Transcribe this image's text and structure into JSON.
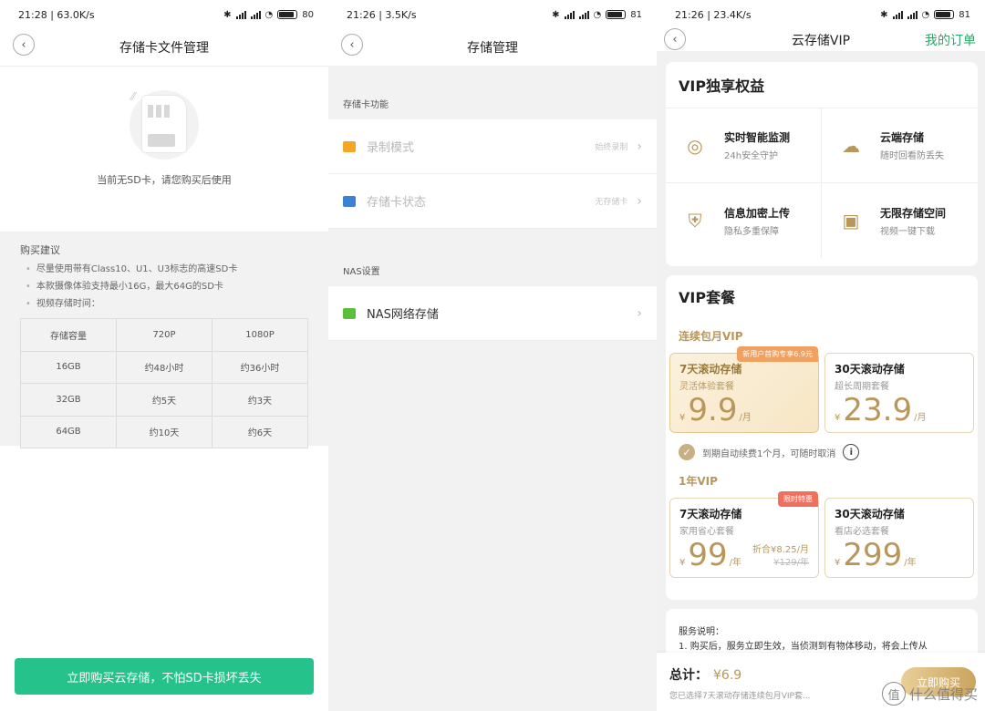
{
  "panel1": {
    "status": {
      "time": "21:28",
      "speed": "63.0K/s",
      "battery": "80"
    },
    "nav": {
      "title": "存储卡文件管理",
      "back_glyph": "‹"
    },
    "empty_msg": "当前无SD卡，请您购买后使用",
    "advice": {
      "heading": "购买建议",
      "items": [
        "尽量使用带有Class10、U1、U3标志的高速SD卡",
        "本款摄像体验支持最小16G，最大64G的SD卡",
        "视频存储时间："
      ]
    },
    "table": {
      "header": [
        "存储容量",
        "720P",
        "1080P"
      ],
      "rows": [
        [
          "16GB",
          "约48小时",
          "约36小时"
        ],
        [
          "32GB",
          "约5天",
          "约3天"
        ],
        [
          "64GB",
          "约10天",
          "约6天"
        ]
      ]
    },
    "buy_button": "立即购买云存储，不怕SD卡损坏丢失",
    "colors": {
      "accent": "#26c28b"
    }
  },
  "panel2": {
    "status": {
      "time": "21:26",
      "speed": "3.5K/s",
      "battery": "81"
    },
    "nav": {
      "title": "存储管理",
      "back_glyph": "‹"
    },
    "section1": "存储卡功能",
    "rows1": [
      {
        "label": "录制模式",
        "value": "始终录制",
        "icon": "video-record-icon",
        "color": "#f5a623"
      },
      {
        "label": "存储卡状态",
        "value": "无存储卡",
        "icon": "sd-card-icon",
        "color": "#3b82d6"
      }
    ],
    "section2": "NAS设置",
    "rows2": [
      {
        "label": "NAS网络存储",
        "icon": "nas-drive-icon",
        "color": "#5cbf3c"
      }
    ]
  },
  "panel3": {
    "status": {
      "time": "21:26",
      "speed": "23.4K/s",
      "battery": "81"
    },
    "nav": {
      "title": "云存储VIP",
      "back_glyph": "‹",
      "my_orders": "我的订单"
    },
    "benefits_title": "VIP独享权益",
    "benefits": [
      {
        "title": "实时智能监测",
        "sub": "24h安全守护",
        "icon": "smart-monitor-icon"
      },
      {
        "title": "云端存储",
        "sub": "随时回看防丢失",
        "icon": "cloud-upload-icon"
      },
      {
        "title": "信息加密上传",
        "sub": "隐私多重保障",
        "icon": "shield-encrypt-icon"
      },
      {
        "title": "无限存储空间",
        "sub": "视频一键下载",
        "icon": "save-disk-icon"
      }
    ],
    "packages_title": "VIP套餐",
    "monthly": {
      "heading": "连续包月VIP",
      "plans": [
        {
          "title": "7天滚动存储",
          "sub": "灵活体验套餐",
          "currency": "¥",
          "price": "9.9",
          "unit": "/月",
          "badge": "新用户首购专享6.9元"
        },
        {
          "title": "30天滚动存储",
          "sub": "超长周期套餐",
          "currency": "¥",
          "price": "23.9",
          "unit": "/月"
        }
      ]
    },
    "renew_text": "到期自动续费1个月，可随时取消",
    "yearly": {
      "heading": "1年VIP",
      "plans": [
        {
          "title": "7天滚动存储",
          "sub": "家用省心套餐",
          "currency": "¥",
          "price": "99",
          "unit": "/年",
          "badge": "限时特惠",
          "monthly_equiv": "折合¥8.25/月",
          "original": "¥129/年"
        },
        {
          "title": "30天滚动存储",
          "sub": "看店必选套餐",
          "currency": "¥",
          "price": "299",
          "unit": "/年"
        }
      ]
    },
    "notes": {
      "heading": "服务说明：",
      "line1": "1. 购买后，服务立即生效，当侦测到有物体移动，将会上传从"
    },
    "total": {
      "label": "总计：",
      "amount": "¥6.9",
      "note": "您已选择7天滚动存储连续包月VIP套..."
    },
    "pay_button": "立即购买",
    "watermark": {
      "logo": "值",
      "text": "什么值得买"
    },
    "colors": {
      "gold": "#b9975b",
      "green": "#26a865",
      "badge_orange": "#f0a060",
      "badge_red": "#f07060"
    }
  }
}
